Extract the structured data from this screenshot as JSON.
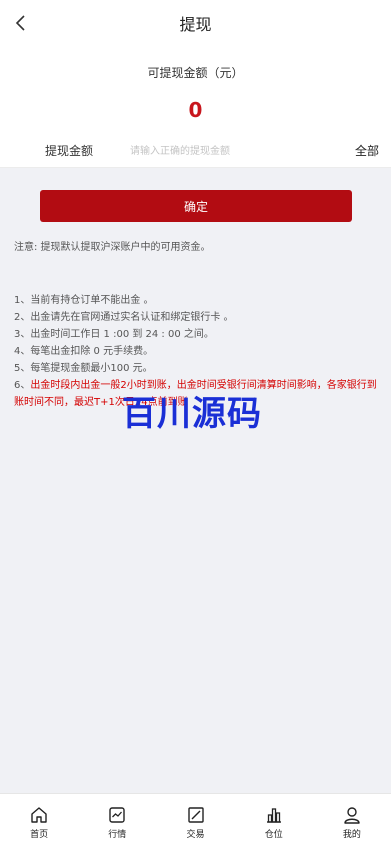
{
  "header": {
    "title": "提现"
  },
  "balance": {
    "label": "可提现金额（元）",
    "value": "0"
  },
  "amount": {
    "label": "提现金额",
    "placeholder": "请输入正确的提现金额",
    "value": "",
    "all_label": "全部"
  },
  "confirm_label": "确定",
  "note": "注意: 提现默认提取沪深账户中的可用资金。",
  "rules": [
    "1、当前有持仓订单不能出金 。",
    "2、出金请先在官网通过实名认证和绑定银行卡 。",
    "3、出金时间工作日 1 :00 到 24 : 00 之间。",
    "4、每笔出金扣除 0 元手续费。",
    "5、每笔提现金额最小100 元。"
  ],
  "rule6": {
    "prefix": "6、",
    "text": "出金时段内出金一般2小时到账，出金时间受银行间清算时间影响，各家银行到账时间不同，最迟T+1次日24点前到账"
  },
  "watermark": "百川源码",
  "tabs": [
    {
      "label": "首页",
      "icon": "home-icon"
    },
    {
      "label": "行情",
      "icon": "chart-icon"
    },
    {
      "label": "交易",
      "icon": "trade-icon"
    },
    {
      "label": "仓位",
      "icon": "position-icon"
    },
    {
      "label": "我的",
      "icon": "user-icon"
    }
  ],
  "colors": {
    "accent": "#b20c12",
    "value_red": "#c8161d",
    "warning_red": "#d40000",
    "watermark_blue": "#1a2fd6"
  }
}
